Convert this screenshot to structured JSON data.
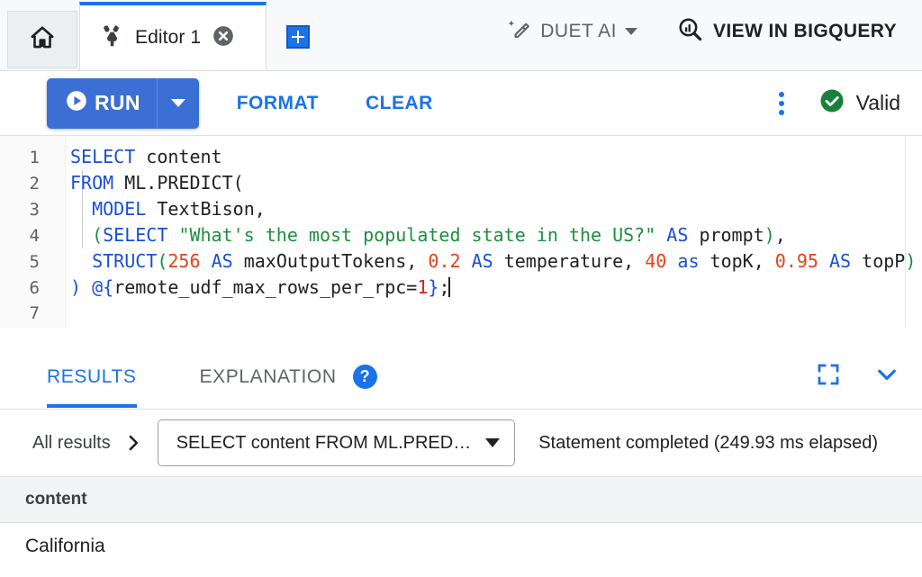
{
  "tabbar": {
    "home_icon": "home-icon",
    "editor_tab": {
      "icon": "wrench-tool-icon",
      "label": "Editor 1",
      "close_icon": "close-circle-icon"
    },
    "add_tab_icon": "plus-icon",
    "duet": {
      "icon": "magic-wand-icon",
      "label": "DUET AI",
      "caret_icon": "chevron-down-icon"
    },
    "view_in_bigquery": {
      "icon": "bigquery-search-icon",
      "label": "VIEW IN BIGQUERY"
    }
  },
  "toolbar": {
    "run_label": "RUN",
    "run_icon": "play-circle-icon",
    "run_caret_icon": "chevron-down-icon",
    "format_label": "FORMAT",
    "clear_label": "CLEAR",
    "more_icon": "kebab-menu-icon",
    "validity": {
      "icon": "check-circle-icon",
      "label": "Valid",
      "color": "#188038"
    }
  },
  "editor": {
    "line_numbers": [
      "1",
      "2",
      "3",
      "4",
      "5",
      "6",
      "7"
    ],
    "code_plain": "SELECT content\nFROM ML.PREDICT(\n  MODEL TextBison,\n  (SELECT \"What's the most populated state in the US?\" AS prompt),\n  STRUCT(256 AS maxOutputTokens, 0.2 AS temperature, 40 as topK, 0.95 AS topP)\n) @{remote_udf_max_rows_per_rpc=1};\n",
    "tokens": [
      [
        [
          "SELECT",
          "k"
        ],
        [
          " ",
          "p"
        ],
        [
          "content",
          "p"
        ]
      ],
      [
        [
          "FROM",
          "k"
        ],
        [
          " ",
          "p"
        ],
        [
          "ML.PREDICT",
          "p"
        ],
        [
          "(",
          "p"
        ]
      ],
      [
        [
          "  ",
          "p"
        ],
        [
          "MODEL",
          "k"
        ],
        [
          " ",
          "p"
        ],
        [
          "TextBison,",
          "p"
        ]
      ],
      [
        [
          "  ",
          "p"
        ],
        [
          "(",
          "gp"
        ],
        [
          "SELECT",
          "k"
        ],
        [
          " ",
          "p"
        ],
        [
          "\"What's the most populated state in the US?\"",
          "s"
        ],
        [
          " ",
          "p"
        ],
        [
          "AS",
          "k"
        ],
        [
          " ",
          "p"
        ],
        [
          "prompt",
          "p"
        ],
        [
          ")",
          "gp"
        ],
        [
          ",",
          "p"
        ]
      ],
      [
        [
          "  ",
          "p"
        ],
        [
          "STRUCT",
          "k"
        ],
        [
          "(",
          "gp"
        ],
        [
          "256",
          "n"
        ],
        [
          " ",
          "p"
        ],
        [
          "AS",
          "k"
        ],
        [
          " ",
          "p"
        ],
        [
          "maxOutputTokens, ",
          "p"
        ],
        [
          "0.2",
          "n"
        ],
        [
          " ",
          "p"
        ],
        [
          "AS",
          "k"
        ],
        [
          " ",
          "p"
        ],
        [
          "temperature, ",
          "p"
        ],
        [
          "40",
          "n"
        ],
        [
          " ",
          "p"
        ],
        [
          "as",
          "k"
        ],
        [
          " ",
          "p"
        ],
        [
          "topK, ",
          "p"
        ],
        [
          "0.95",
          "n"
        ],
        [
          " ",
          "p"
        ],
        [
          "AS",
          "k"
        ],
        [
          " ",
          "p"
        ],
        [
          "topP",
          "p"
        ],
        [
          ")",
          "gp"
        ]
      ],
      [
        [
          ")",
          "bp"
        ],
        [
          " ",
          "p"
        ],
        [
          "@{",
          "bp"
        ],
        [
          "remote_udf_max_rows_per_rpc=",
          "p"
        ],
        [
          "1",
          "rn"
        ],
        [
          "}",
          "bp"
        ],
        [
          ";",
          "p"
        ]
      ],
      []
    ],
    "scrollbar": "horizontal-scrollbar",
    "resize_handle": "panel-resize-handle"
  },
  "results": {
    "tabs": [
      {
        "label": "RESULTS",
        "active": true
      },
      {
        "label": "EXPLANATION",
        "active": false
      }
    ],
    "help_label": "?",
    "expand_icon": "fullscreen-icon",
    "collapse_icon": "chevron-down-icon",
    "breadcrumb_label": "All results",
    "breadcrumb_arrow_icon": "chevron-right-icon",
    "statement_select": {
      "value": "SELECT content FROM ML.PRED…",
      "caret_icon": "chevron-down-icon"
    },
    "status": "Statement completed (249.93 ms elapsed)",
    "table": {
      "columns": [
        "content"
      ],
      "rows": [
        [
          "California"
        ]
      ]
    }
  },
  "colors": {
    "accent": "#1a73e8",
    "run_button": "#3c6fd4",
    "success": "#188038",
    "keyword": "#1a4fd6",
    "string": "#1e8e3e",
    "number": "#e8401a",
    "tabbar_bg": "#f8f9fa"
  }
}
